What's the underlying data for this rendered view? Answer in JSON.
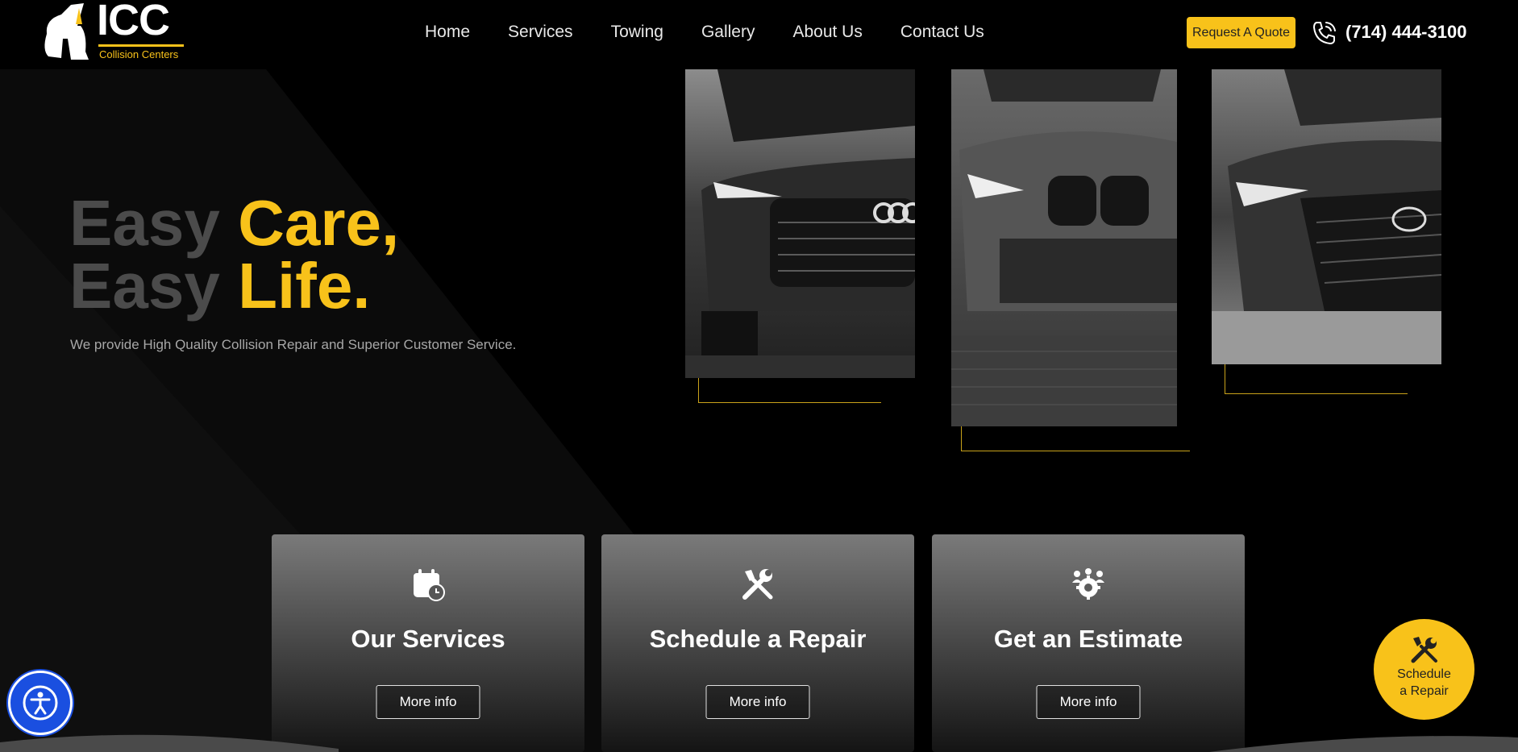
{
  "header": {
    "logo": {
      "name": "ICC",
      "subtitle": "Collision Centers"
    },
    "nav": [
      {
        "label": "Home"
      },
      {
        "label": "Services"
      },
      {
        "label": "Towing"
      },
      {
        "label": "Gallery"
      },
      {
        "label": "About Us"
      },
      {
        "label": "Contact Us"
      }
    ],
    "quote_button": "Request A Quote",
    "phone_icon": "phone-icon",
    "phone": "(714) 444-3100"
  },
  "hero": {
    "line1_dim": "Easy",
    "line1_gold": "Care,",
    "line2_dim": "Easy",
    "line2_gold": "Life.",
    "subtitle": "We provide High Quality Collision Repair and Superior Customer Service."
  },
  "cards": [
    {
      "icon": "calendar-clock-icon",
      "title": "Our Services",
      "button": "More info"
    },
    {
      "icon": "wrench-screwdriver-icon",
      "title": "Schedule a Repair",
      "button": "More info"
    },
    {
      "icon": "team-gear-icon",
      "title": "Get an Estimate",
      "button": "More info"
    }
  ],
  "floating": {
    "accessibility_icon": "accessibility-icon",
    "schedule_line1": "Schedule",
    "schedule_line2": "a Repair"
  },
  "colors": {
    "accent": "#f8c21a",
    "background": "#000000",
    "muted_text": "#4b4b4b",
    "accessibility": "#1a4fe0"
  }
}
